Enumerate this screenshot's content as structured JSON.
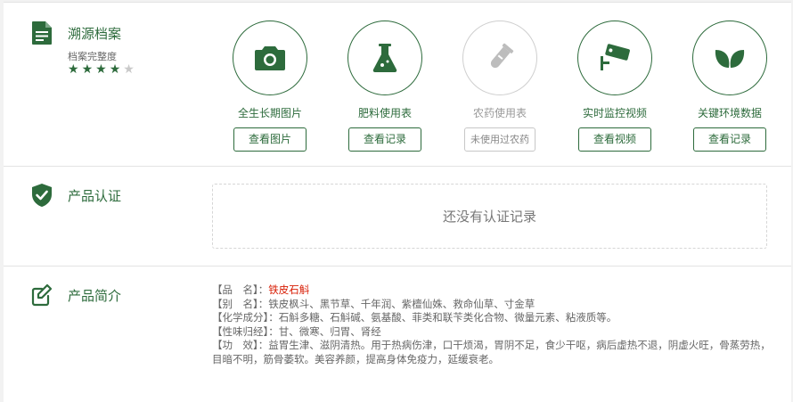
{
  "trace": {
    "title": "溯源档案",
    "completeness_label": "档案完整度",
    "rating": {
      "value": 4,
      "max": 5
    },
    "features": [
      {
        "label": "全生长期图片",
        "button": "查看图片",
        "icon": "camera-icon",
        "enabled": true
      },
      {
        "label": "肥料使用表",
        "button": "查看记录",
        "icon": "flask-icon",
        "enabled": true
      },
      {
        "label": "农药使用表",
        "button": "未使用过农药",
        "icon": "test-tube-icon",
        "enabled": false
      },
      {
        "label": "实时监控视频",
        "button": "查看视频",
        "icon": "cctv-camera-icon",
        "enabled": true
      },
      {
        "label": "关键环境数据",
        "button": "查看记录",
        "icon": "leaf-icon",
        "enabled": true
      }
    ]
  },
  "certification": {
    "title": "产品认证",
    "empty_text": "还没有认证记录"
  },
  "intro": {
    "title": "产品简介",
    "lines": [
      {
        "key": "【品　名】：",
        "value": "铁皮石斛"
      },
      {
        "key": "【别　名】：",
        "value": "铁皮枫斗、黑节草、千年润、紫檀仙姝、救命仙草、寸金草"
      },
      {
        "key": "【化学成分】：",
        "value": "石斛多糖、石斛碱、氨基酸、菲类和联苄类化合物、微量元素、粘液质等。"
      },
      {
        "key": "【性味归经】：",
        "value": "甘、微寒、归胃、肾经"
      },
      {
        "key": "【功　效】：",
        "value": "益胃生津、滋阴清热。用于热病伤津，口干烦渴，胃阴不足，食少干呕，病后虚热不退，阴虚火旺，骨蒸劳热，目暗不明，筋骨萎软。美容养颜，提高身体免疫力，延缓衰老。"
      }
    ]
  },
  "colors": {
    "accent": "#2d6b3c",
    "highlight": "#d81e06",
    "disabled": "#cfcfcf"
  }
}
